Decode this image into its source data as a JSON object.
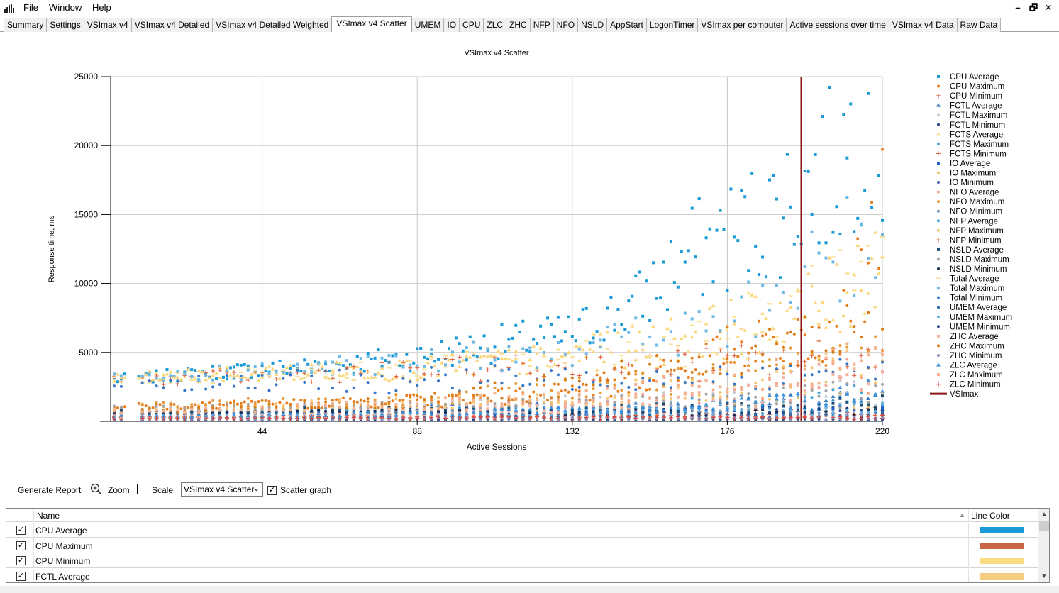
{
  "menu": {
    "items": [
      "File",
      "Window",
      "Help"
    ]
  },
  "window_controls": {
    "minimize": "–",
    "restore": "🗗",
    "close": "✕"
  },
  "tabs": [
    {
      "label": "Summary"
    },
    {
      "label": "Settings"
    },
    {
      "label": "VSImax v4"
    },
    {
      "label": "VSImax v4 Detailed"
    },
    {
      "label": "VSImax v4 Detailed Weighted"
    },
    {
      "label": "VSImax v4 Scatter",
      "active": true
    },
    {
      "label": "UMEM"
    },
    {
      "label": "IO"
    },
    {
      "label": "CPU"
    },
    {
      "label": "ZLC"
    },
    {
      "label": "ZHC"
    },
    {
      "label": "NFP"
    },
    {
      "label": "NFO"
    },
    {
      "label": "NSLD"
    },
    {
      "label": "AppStart"
    },
    {
      "label": "LogonTimer"
    },
    {
      "label": "VSImax per computer"
    },
    {
      "label": "Active sessions over time"
    },
    {
      "label": "VSImax v4 Data"
    },
    {
      "label": "Raw Data"
    }
  ],
  "chart_data": {
    "type": "scatter",
    "title": "VSImax v4 Scatter",
    "xlabel": "Active Sessions",
    "ylabel": "Response time, ms",
    "xlim": [
      1,
      220
    ],
    "ylim": [
      0,
      25000
    ],
    "x_ticks": [
      44,
      88,
      132,
      176,
      220
    ],
    "y_ticks": [
      5000,
      10000,
      15000,
      20000,
      25000
    ],
    "grid": true,
    "legend_position": "right",
    "vsimax_x": 197,
    "series": [
      {
        "name": "CPU Average",
        "color": "#1a9ad6",
        "marker": "square",
        "values": [
          [
            2,
            3000
          ],
          [
            22,
            3400
          ],
          [
            44,
            3800
          ],
          [
            66,
            4100
          ],
          [
            88,
            4700
          ],
          [
            110,
            5600
          ],
          [
            132,
            6300
          ],
          [
            150,
            8500
          ],
          [
            166,
            12200
          ],
          [
            176,
            13300
          ],
          [
            188,
            14900
          ],
          [
            198,
            17000
          ],
          [
            205,
            18000
          ],
          [
            212,
            20800
          ],
          [
            216,
            23900
          ],
          [
            220,
            19600
          ]
        ]
      },
      {
        "name": "CPU Maximum",
        "color": "#e87d1e",
        "marker": "circle",
        "values": [
          [
            2,
            1050
          ],
          [
            44,
            1200
          ],
          [
            88,
            1500
          ],
          [
            132,
            2000
          ],
          [
            160,
            3500
          ],
          [
            176,
            5300
          ],
          [
            198,
            6000
          ],
          [
            210,
            7500
          ],
          [
            220,
            15000
          ]
        ]
      },
      {
        "name": "CPU Minimum",
        "color": "#d94f2b",
        "marker": "plus",
        "values": [
          [
            2,
            300
          ],
          [
            88,
            400
          ],
          [
            176,
            500
          ],
          [
            220,
            700
          ]
        ]
      },
      {
        "name": "FCTL Average",
        "color": "#3778c4",
        "marker": "triangle",
        "values": [
          [
            2,
            700
          ],
          [
            88,
            900
          ],
          [
            176,
            1300
          ],
          [
            220,
            1700
          ]
        ]
      },
      {
        "name": "FCTL Maximum",
        "color": "#c7c7cf",
        "marker": "circle",
        "values": [
          [
            2,
            900
          ],
          [
            88,
            1100
          ],
          [
            176,
            1600
          ],
          [
            220,
            2300
          ]
        ]
      },
      {
        "name": "FCTL Minimum",
        "color": "#2a4b8f",
        "marker": "circle",
        "values": [
          [
            2,
            500
          ],
          [
            88,
            600
          ],
          [
            176,
            700
          ],
          [
            220,
            800
          ]
        ]
      },
      {
        "name": "FCTS Average",
        "color": "#fbd67a",
        "marker": "triangle",
        "values": [
          [
            2,
            3100
          ],
          [
            44,
            3500
          ],
          [
            88,
            3800
          ],
          [
            132,
            4600
          ],
          [
            166,
            6200
          ],
          [
            188,
            7400
          ],
          [
            208,
            9000
          ],
          [
            218,
            12600
          ]
        ]
      },
      {
        "name": "FCTS Maximum",
        "color": "#4ba3d8",
        "marker": "circle",
        "values": [
          [
            2,
            200
          ],
          [
            110,
            300
          ],
          [
            220,
            500
          ]
        ]
      },
      {
        "name": "FCTS Minimum",
        "color": "#e06a4a",
        "marker": "plus",
        "values": [
          [
            2,
            2950
          ],
          [
            44,
            3300
          ],
          [
            88,
            3700
          ],
          [
            132,
            4000
          ],
          [
            176,
            4200
          ],
          [
            220,
            4600
          ]
        ]
      },
      {
        "name": "IO Average",
        "color": "#1f63c6",
        "marker": "square",
        "values": [
          [
            2,
            400
          ],
          [
            88,
            500
          ],
          [
            176,
            700
          ],
          [
            220,
            900
          ]
        ]
      },
      {
        "name": "IO Maximum",
        "color": "#f3c26b",
        "marker": "circle",
        "values": [
          [
            2,
            800
          ],
          [
            88,
            1000
          ],
          [
            176,
            1500
          ],
          [
            220,
            2100
          ]
        ]
      },
      {
        "name": "IO Minimum",
        "color": "#3a5da8",
        "marker": "circle",
        "values": [
          [
            2,
            100
          ],
          [
            110,
            150
          ],
          [
            220,
            200
          ]
        ]
      },
      {
        "name": "NFO Average",
        "color": "#f5a38d",
        "marker": "circle",
        "values": [
          [
            2,
            600
          ],
          [
            88,
            800
          ],
          [
            176,
            1700
          ],
          [
            220,
            3300
          ]
        ]
      },
      {
        "name": "NFO Maximum",
        "color": "#e89a3c",
        "marker": "circle",
        "values": [
          [
            2,
            1100
          ],
          [
            88,
            1600
          ],
          [
            176,
            3300
          ],
          [
            220,
            5200
          ]
        ]
      },
      {
        "name": "NFO Minimum",
        "color": "#7b9ac7",
        "marker": "circle",
        "values": [
          [
            2,
            350
          ],
          [
            110,
            400
          ],
          [
            220,
            450
          ]
        ]
      },
      {
        "name": "NFP Average",
        "color": "#48a6df",
        "marker": "circle",
        "values": [
          [
            2,
            500
          ],
          [
            88,
            700
          ],
          [
            176,
            1200
          ],
          [
            220,
            1900
          ]
        ]
      },
      {
        "name": "NFP Maximum",
        "color": "#f7c978",
        "marker": "circle",
        "values": [
          [
            2,
            900
          ],
          [
            88,
            1300
          ],
          [
            176,
            2500
          ],
          [
            220,
            4300
          ]
        ]
      },
      {
        "name": "NFP Minimum",
        "color": "#e05a2a",
        "marker": "plus",
        "values": [
          [
            2,
            250
          ],
          [
            110,
            300
          ],
          [
            220,
            350
          ]
        ]
      },
      {
        "name": "NSLD Average",
        "color": "#1a4f7a",
        "marker": "square",
        "values": [
          [
            2,
            750
          ],
          [
            88,
            800
          ],
          [
            176,
            900
          ],
          [
            220,
            1200
          ]
        ]
      },
      {
        "name": "NSLD Maximum",
        "color": "#a3a3a3",
        "marker": "circle",
        "values": [
          [
            2,
            950
          ],
          [
            88,
            1100
          ],
          [
            176,
            1500
          ],
          [
            220,
            2100
          ]
        ]
      },
      {
        "name": "NSLD Minimum",
        "color": "#1b2e5a",
        "marker": "circle",
        "values": [
          [
            2,
            600
          ],
          [
            110,
            650
          ],
          [
            220,
            700
          ]
        ]
      },
      {
        "name": "Total Average",
        "color": "#fbe09a",
        "marker": "dash",
        "values": [
          [
            2,
            3000
          ],
          [
            88,
            3900
          ],
          [
            176,
            5800
          ],
          [
            220,
            10600
          ]
        ]
      },
      {
        "name": "Total Maximum",
        "color": "#6eb9e5",
        "marker": "square",
        "values": [
          [
            2,
            3100
          ],
          [
            88,
            4200
          ],
          [
            176,
            6800
          ],
          [
            220,
            14000
          ]
        ]
      },
      {
        "name": "Total Minimum",
        "color": "#3775c6",
        "marker": "circle",
        "values": [
          [
            2,
            2800
          ],
          [
            110,
            3000
          ],
          [
            220,
            3500
          ]
        ]
      },
      {
        "name": "UMEM Average",
        "color": "#2a6db5",
        "marker": "circle",
        "values": [
          [
            2,
            200
          ],
          [
            88,
            250
          ],
          [
            176,
            350
          ],
          [
            220,
            450
          ]
        ]
      },
      {
        "name": "UMEM Maximum",
        "color": "#68aedd",
        "marker": "circle",
        "values": [
          [
            2,
            400
          ],
          [
            88,
            500
          ],
          [
            176,
            700
          ],
          [
            220,
            900
          ]
        ]
      },
      {
        "name": "UMEM Minimum",
        "color": "#2b4c86",
        "marker": "circle",
        "values": [
          [
            2,
            100
          ],
          [
            110,
            120
          ],
          [
            220,
            150
          ]
        ]
      },
      {
        "name": "ZHC Average",
        "color": "#f4b2a0",
        "marker": "square",
        "values": [
          [
            2,
            300
          ],
          [
            88,
            500
          ],
          [
            176,
            1600
          ],
          [
            220,
            3700
          ]
        ]
      },
      {
        "name": "ZHC Maximum",
        "color": "#d97c18",
        "marker": "circle",
        "values": [
          [
            2,
            700
          ],
          [
            88,
            1400
          ],
          [
            176,
            4500
          ],
          [
            220,
            8000
          ]
        ]
      },
      {
        "name": "ZHC Minimum",
        "color": "#8a94c4",
        "marker": "circle",
        "values": [
          [
            2,
            150
          ],
          [
            110,
            200
          ],
          [
            220,
            300
          ]
        ]
      },
      {
        "name": "ZLC Average",
        "color": "#3f8fd8",
        "marker": "triangle",
        "values": [
          [
            2,
            350
          ],
          [
            88,
            500
          ],
          [
            176,
            1100
          ],
          [
            220,
            2100
          ]
        ]
      },
      {
        "name": "ZLC Maximum",
        "color": "#f5b28c",
        "marker": "square",
        "values": [
          [
            2,
            700
          ],
          [
            88,
            1200
          ],
          [
            176,
            2600
          ],
          [
            220,
            5000
          ]
        ]
      },
      {
        "name": "ZLC Minimum",
        "color": "#e2473a",
        "marker": "plus",
        "values": [
          [
            2,
            200
          ],
          [
            110,
            250
          ],
          [
            220,
            300
          ]
        ]
      }
    ],
    "vsimax_label": "VSImax",
    "vsimax_color": "#8b1a1a"
  },
  "toolbar": {
    "generate_report": "Generate Report",
    "zoom": "Zoom",
    "scale": "Scale",
    "chart_select": "VSImax v4 Scatter",
    "scatter_graph": "Scatter graph",
    "scatter_checked": true
  },
  "grid": {
    "columns": {
      "name": "Name",
      "line_color": "Line Color"
    },
    "rows": [
      {
        "name": "CPU Average",
        "checked": true,
        "color": "#1a9ad6"
      },
      {
        "name": "CPU Maximum",
        "checked": true,
        "color": "#c86644"
      },
      {
        "name": "CPU Minimum",
        "checked": true,
        "color": "#fbdd80"
      },
      {
        "name": "FCTL Average",
        "checked": true,
        "color": "#f6cd80"
      }
    ]
  }
}
